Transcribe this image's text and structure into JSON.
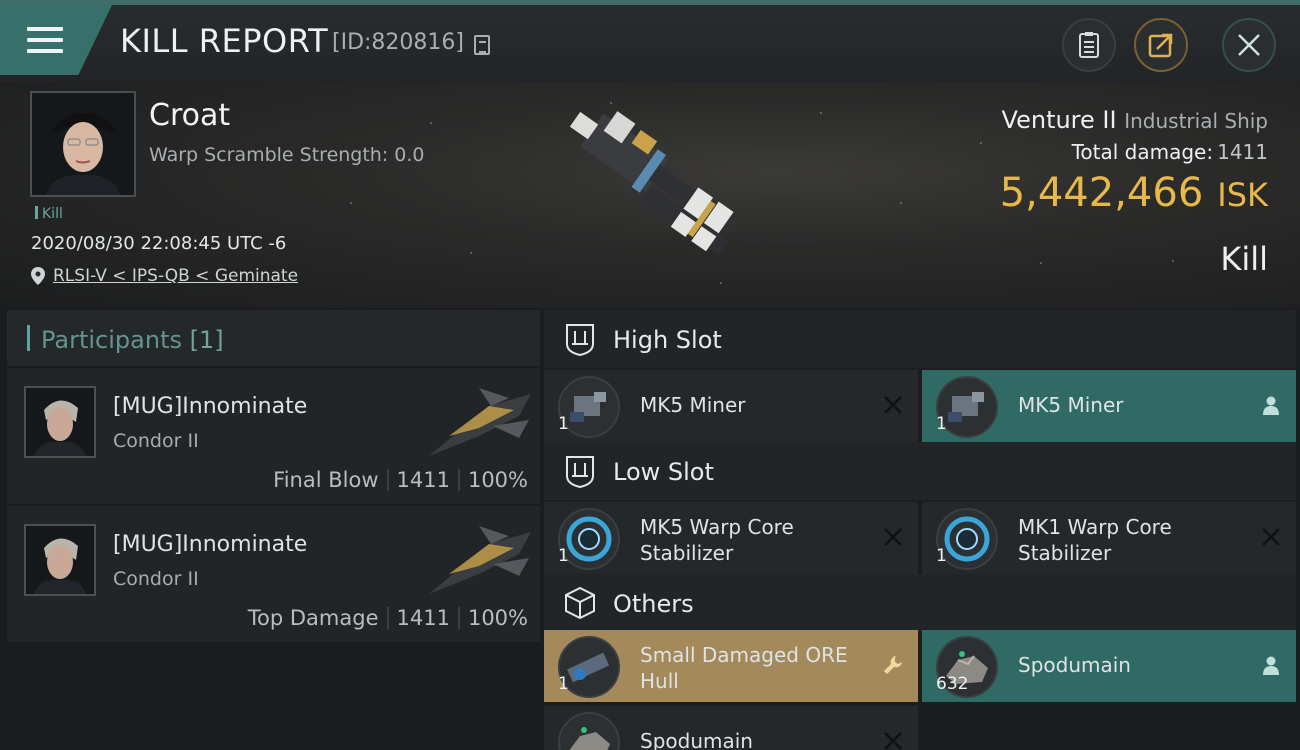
{
  "header": {
    "title": "KILL REPORT",
    "report_id": "[ID:820816]",
    "icons": [
      "menu-icon",
      "copy-icon",
      "clipboard-icon",
      "share-icon",
      "close-icon"
    ]
  },
  "victim": {
    "name": "Croat",
    "warp_scramble": "Warp Scramble Strength: 0.0",
    "tag": "Kill",
    "datetime": "2020/08/30 22:08:45 UTC -6",
    "location": "RLSI-V < IPS-QB < Geminate",
    "ship_name": "Venture II",
    "ship_class": "Industrial Ship",
    "total_damage_label": "Total damage:",
    "total_damage": "1411",
    "isk_value": "5,442,466",
    "isk_unit": "ISK",
    "report_kind": "Kill"
  },
  "participants": {
    "label": "Participants",
    "count": "[1]",
    "rows": [
      {
        "name": "[MUG]Innominate",
        "ship": "Condor II",
        "role": "Final Blow",
        "damage": "1411",
        "percent": "100%"
      },
      {
        "name": "[MUG]Innominate",
        "ship": "Condor II",
        "role": "Top Damage",
        "damage": "1411",
        "percent": "100%"
      }
    ]
  },
  "slots": {
    "high": {
      "label": "High Slot",
      "items": [
        {
          "name": "MK5 Miner",
          "qty": "1",
          "status": "destroyed"
        },
        {
          "name": "MK5 Miner",
          "qty": "1",
          "status": "dropped"
        }
      ]
    },
    "low": {
      "label": "Low Slot",
      "items": [
        {
          "name": "MK5 Warp Core Stabilizer",
          "qty": "1",
          "status": "destroyed"
        },
        {
          "name": "MK1 Warp Core Stabilizer",
          "qty": "1",
          "status": "destroyed"
        }
      ]
    },
    "others": {
      "label": "Others",
      "items": [
        {
          "name": "Small Damaged ORE Hull",
          "qty": "1",
          "status": "salvage"
        },
        {
          "name": "Spodumain",
          "qty": "632",
          "status": "dropped"
        },
        {
          "name": "Spodumain",
          "qty": "",
          "status": "destroyed"
        }
      ]
    }
  },
  "colors": {
    "accent_teal": "#2f6b64",
    "isk_gold": "#e8b84a",
    "salvage_gold": "#a4895a",
    "background": "#17191c"
  }
}
